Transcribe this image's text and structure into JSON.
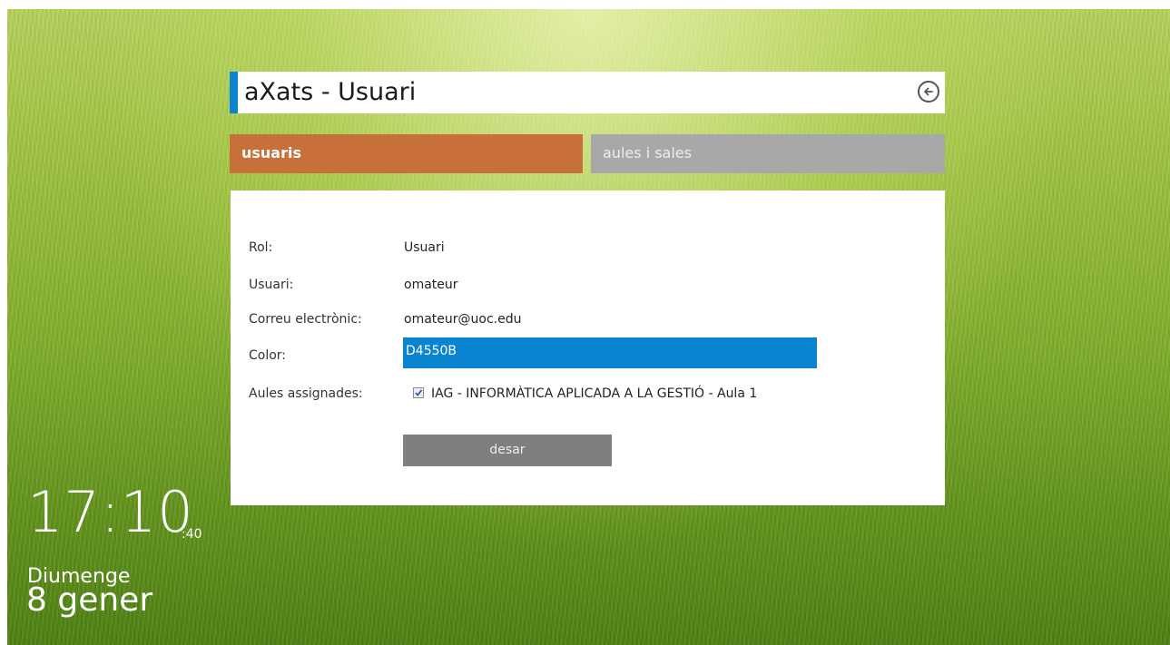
{
  "header": {
    "title": "aXats - Usuari",
    "back_icon": "arrow-left-circle-icon"
  },
  "tabs": [
    {
      "label": "usuaris",
      "active": true,
      "color": "#C8703A"
    },
    {
      "label": "aules i sales",
      "active": false,
      "color": "#A8A8A8"
    }
  ],
  "form": {
    "rol_label": "Rol:",
    "rol_value": "Usuari",
    "usuari_label": "Usuari:",
    "usuari_value": "omateur",
    "email_label": "Correu electrònic:",
    "email_value": "omateur@uoc.edu",
    "color_label": "Color:",
    "color_value": "D4550B",
    "aules_label": "Aules assignades:",
    "aules": [
      {
        "label": "IAG - INFORMÀTICA APLICADA A LA GESTIÓ - Aula 1",
        "checked": true
      }
    ],
    "save_label": "desar"
  },
  "clock": {
    "time": "17:10",
    "seconds": ":40",
    "day": "Diumenge",
    "date": "8 gener"
  },
  "colors": {
    "accent": "#0A84D0",
    "active_tab": "#C8703A",
    "inactive_tab": "#A8A8A8",
    "save_button": "#7F7F7F"
  }
}
